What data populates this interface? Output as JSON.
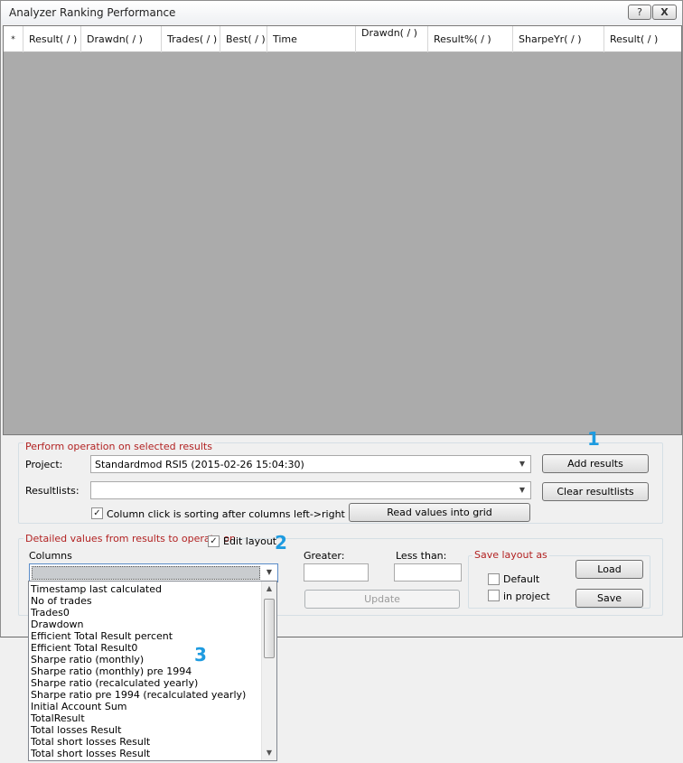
{
  "window": {
    "title": "Analyzer Ranking Performance",
    "help_label": "?",
    "close_label": "X"
  },
  "grid": {
    "corner": "*",
    "columns": [
      "Result( / )",
      "Drawdn( / )",
      "Trades( / )",
      "Best( / )",
      "Time",
      "Drawdn( / )",
      "Result%( / )",
      "SharpeYr( / )",
      "Result( / )"
    ]
  },
  "perform": {
    "legend": "Perform operation on selected results",
    "project_label": "Project:",
    "project_value": "Standardmod RSI5  (2015-02-26 15:04:30)",
    "resultlists_label": "Resultlists:",
    "resultlists_value": "",
    "sort_checkbox_label": "Column click is sorting after columns left->right",
    "add_results": "Add results",
    "clear_resultlists": "Clear resultlists",
    "read_values": "Read values into grid"
  },
  "detailed": {
    "legend": "Detailed values from results to operate on",
    "edit_layout_label": "Edit layout",
    "columns_label": "Columns",
    "greater_label": "Greater:",
    "less_label": "Less than:",
    "update": "Update",
    "save_layout_legend": "Save layout as",
    "default_label": "Default",
    "in_project_label": "in project",
    "load": "Load",
    "save": "Save"
  },
  "dropdown_items": [
    "Timestamp last calculated",
    "No of trades",
    "Trades0",
    "Drawdown",
    "Efficient Total Result percent",
    "Efficient Total Result0",
    "Sharpe ratio (monthly)",
    "Sharpe ratio (monthly) pre 1994",
    "Sharpe ratio (recalculated yearly)",
    "Sharpe ratio pre 1994 (recalculated yearly)",
    "Initial Account Sum",
    "TotalResult",
    "Total losses Result",
    "Total short losses Result",
    "Total short losses Result"
  ],
  "markers": {
    "one": "1",
    "two": "2",
    "three": "3"
  },
  "colors": {
    "legend": "#b22222",
    "grid_bg": "#ababab",
    "marker": "#1e9be0"
  }
}
